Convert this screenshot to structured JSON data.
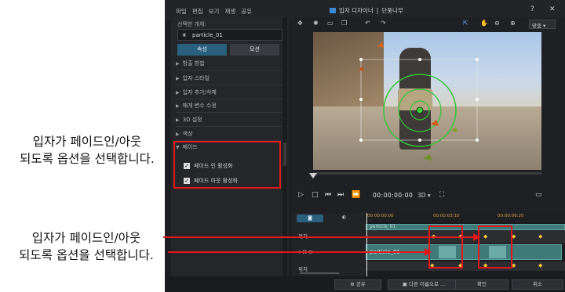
{
  "annotations": {
    "top_line1": "입자가 페이드인/아웃",
    "top_line2": "되도록 옵션을 선택합니다.",
    "bottom_line1": "입자가 페이드인/아웃",
    "bottom_line2": "되도록 옵션을 선택합니다."
  },
  "window": {
    "menu": [
      "파일",
      "편집",
      "보기",
      "재생",
      "공유"
    ],
    "title": "입자 디자이너",
    "title_separator": "|",
    "title_right": "단풍나무",
    "help": "?",
    "close": "✕"
  },
  "left_panel": {
    "selected_label": "선택한 개체:",
    "selected_value": "particle_01",
    "tabs": [
      "속성",
      "모션"
    ],
    "sections": [
      "방출 방법",
      "입자 스타일",
      "입자 추가/삭제",
      "매개 변수 수정",
      "3D 설정",
      "색상",
      "페이드"
    ],
    "fade_in_label": "페이드 인 활성화",
    "fade_out_label": "페이드 아웃 활성화",
    "fade_in_checked": true,
    "fade_out_checked": true
  },
  "toolbar": {
    "zoom_value": "맞춤"
  },
  "playback": {
    "timecode": "00:00:00:00",
    "mode_3d": "3D"
  },
  "timeline": {
    "ruler_ticks": [
      "00:00:00:00",
      "00:00:03:10",
      "00:00:06:20"
    ],
    "track_label_top": "위치",
    "track_label_bottom": "위치",
    "clip_label_top": "particle_01",
    "clip_label": "particle_01"
  },
  "footer": {
    "share": "공유",
    "save_as": "다른 이름으로 ...",
    "ok": "확인",
    "cancel": "취소"
  },
  "colors": {
    "accent_tab": "#2a5f7d",
    "annotation_red": "#e0191a",
    "clip_teal": "#3f7a78",
    "keyframe": "#f4c542"
  }
}
